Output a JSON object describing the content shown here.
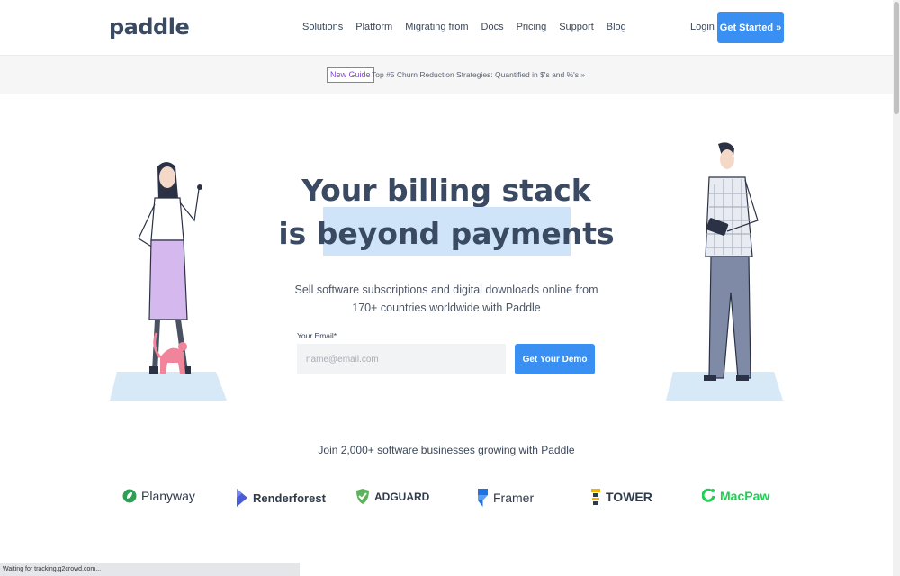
{
  "header": {
    "logo": "paddle",
    "nav": [
      "Solutions",
      "Platform",
      "Migrating from",
      "Docs",
      "Pricing",
      "Support",
      "Blog"
    ],
    "login": "Login",
    "cta": "Get Started »"
  },
  "announcement": {
    "badge": "New Guide",
    "text": "Top #5 Churn Reduction Strategies: Quantified in $'s and %'s »"
  },
  "hero": {
    "headline_line1": "Your billing stack",
    "headline_line2": "is beyond payments",
    "subtitle": "Sell software subscriptions and digital downloads online from 170+ countries worldwide with Paddle",
    "email_label": "Your Email*",
    "email_placeholder": "name@email.com",
    "demo_button": "Get Your Demo"
  },
  "social_proof": {
    "heading": "Join 2,000+ software businesses growing with Paddle",
    "brands": [
      {
        "name": "Planyway",
        "icon": "planyway-leaf-icon",
        "color": "#2e9f55"
      },
      {
        "name": "Renderforest",
        "icon": "renderforest-play-icon",
        "color": "#4a5bd6"
      },
      {
        "name": "ADGUARD",
        "icon": "adguard-shield-icon",
        "color": "#5fb25c"
      },
      {
        "name": "Framer",
        "icon": "framer-icon",
        "color": "#1f73e8"
      },
      {
        "name": "TOWER",
        "icon": "tower-icon",
        "color": "#f0b400"
      },
      {
        "name": "MacPaw",
        "icon": "macpaw-icon",
        "color": "#1fcf52"
      }
    ]
  },
  "status_bar": "Waiting for tracking.g2crowd.com..."
}
